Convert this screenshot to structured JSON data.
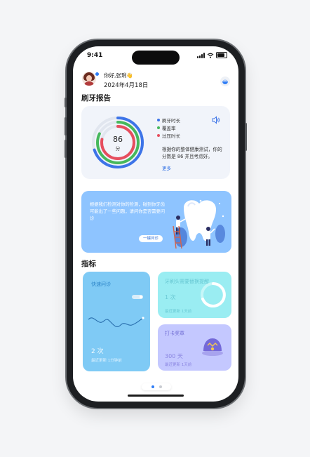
{
  "status_bar": {
    "time": "9:41"
  },
  "header": {
    "greeting": "你好,张琍👋",
    "date": "2024年4月18日"
  },
  "report": {
    "title": "刷牙报告",
    "score": "86",
    "score_unit": "分",
    "legend": [
      {
        "label": "刷牙时长",
        "color": "#3d74e8"
      },
      {
        "label": "覆盖率",
        "color": "#46b85c"
      },
      {
        "label": "过压时长",
        "color": "#e64e5e"
      }
    ],
    "rings": [
      {
        "label": "刷牙时长",
        "fraction": 0.7
      },
      {
        "label": "覆盖率",
        "fraction": 0.82
      },
      {
        "label": "过压时长",
        "fraction": 0.78
      }
    ],
    "description": "根据你的整体健康测试，你的分数是 86 并且考虑好。",
    "more": "更多"
  },
  "banner": {
    "text": "根据我们检测对你的检测，碰到你牙齿可能出了一些问题，请问你是否需要问诊",
    "button": "一键问诊"
  },
  "indicators": {
    "title": "指标",
    "card_a": {
      "title": "快速问诊",
      "value": "2 次",
      "sub": "最近更新 1分钟前"
    },
    "card_b": {
      "title": "牙刷头需要替换提醒",
      "value": "1 次",
      "sub": "最近更新 1天前"
    },
    "card_c": {
      "title": "打卡奖章",
      "value": "300 天",
      "sub": "最近更新 1天前"
    }
  },
  "pager": {
    "active_color": "#2f7df6",
    "inactive_color": "#c9ccd2"
  }
}
